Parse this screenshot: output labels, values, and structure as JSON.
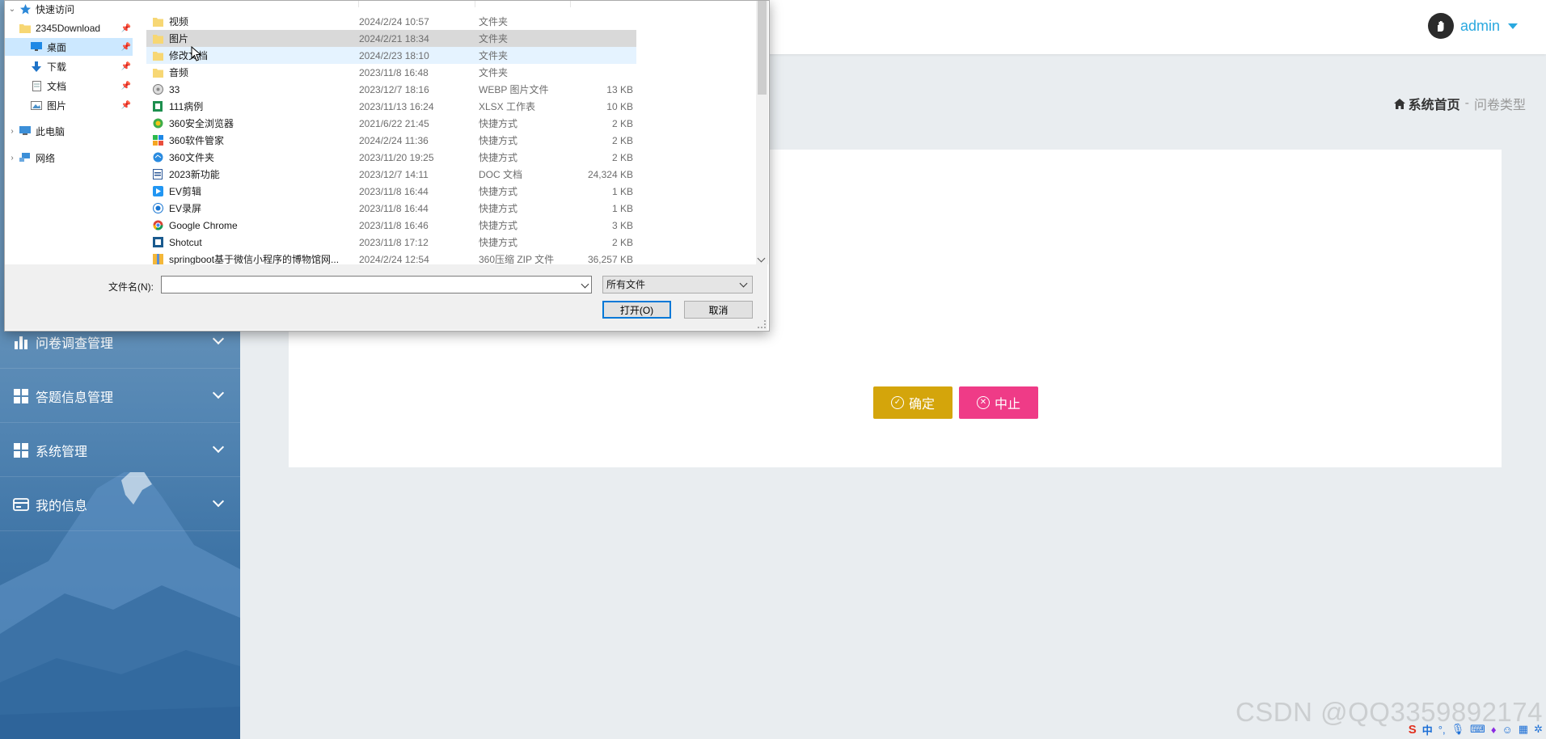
{
  "header": {
    "username": "admin",
    "breadcrumb_home": "系统首页",
    "breadcrumb_sep": "-",
    "breadcrumb_current": "问卷类型"
  },
  "sidebar": {
    "items": [
      {
        "label": "问卷调查管理",
        "icon": "bar-chart-icon"
      },
      {
        "label": "答题信息管理",
        "icon": "grid-icon"
      },
      {
        "label": "系统管理",
        "icon": "grid-icon"
      },
      {
        "label": "我的信息",
        "icon": "id-card-icon"
      }
    ]
  },
  "actions": {
    "confirm_label": "确定",
    "stop_label": "中止"
  },
  "dialog": {
    "nav": [
      {
        "label": "快速访问",
        "icon": "star-icon",
        "expanded": true
      },
      {
        "label": "2345Download",
        "icon": "folder-icon",
        "pinned": true
      },
      {
        "label": "桌面",
        "icon": "desktop-icon",
        "pinned": true,
        "selected": true
      },
      {
        "label": "下载",
        "icon": "download-icon",
        "pinned": true
      },
      {
        "label": "文档",
        "icon": "document-icon",
        "pinned": true
      },
      {
        "label": "图片",
        "icon": "picture-icon",
        "pinned": true
      },
      {
        "label": "此电脑",
        "icon": "computer-icon",
        "expanded": false
      },
      {
        "label": "网络",
        "icon": "network-icon",
        "expanded": false
      }
    ],
    "files": [
      {
        "name": "视频",
        "date": "2024/2/24 10:57",
        "type": "文件夹",
        "size": "",
        "icon": "folder"
      },
      {
        "name": "图片",
        "date": "2024/2/21 18:34",
        "type": "文件夹",
        "size": "",
        "icon": "folder"
      },
      {
        "name": "修改文档",
        "date": "2024/2/23 18:10",
        "type": "文件夹",
        "size": "",
        "icon": "folder"
      },
      {
        "name": "音频",
        "date": "2023/11/8 16:48",
        "type": "文件夹",
        "size": "",
        "icon": "folder"
      },
      {
        "name": "33",
        "date": "2023/12/7 18:16",
        "type": "WEBP 图片文件",
        "size": "13 KB",
        "icon": "webp"
      },
      {
        "name": "111病例",
        "date": "2023/11/13 16:24",
        "type": "XLSX 工作表",
        "size": "10 KB",
        "icon": "xlsx"
      },
      {
        "name": "360安全浏览器",
        "date": "2021/6/22 21:45",
        "type": "快捷方式",
        "size": "2 KB",
        "icon": "browser360"
      },
      {
        "name": "360软件管家",
        "date": "2024/2/24 11:36",
        "type": "快捷方式",
        "size": "2 KB",
        "icon": "softmgr"
      },
      {
        "name": "360文件夹",
        "date": "2023/11/20 19:25",
        "type": "快捷方式",
        "size": "2 KB",
        "icon": "folder360"
      },
      {
        "name": "2023新功能",
        "date": "2023/12/7 14:11",
        "type": "DOC 文档",
        "size": "24,324 KB",
        "icon": "doc"
      },
      {
        "name": "EV剪辑",
        "date": "2023/11/8 16:44",
        "type": "快捷方式",
        "size": "1 KB",
        "icon": "ev"
      },
      {
        "name": "EV录屏",
        "date": "2023/11/8 16:44",
        "type": "快捷方式",
        "size": "1 KB",
        "icon": "ev2"
      },
      {
        "name": "Google Chrome",
        "date": "2023/11/8 16:46",
        "type": "快捷方式",
        "size": "3 KB",
        "icon": "chrome"
      },
      {
        "name": "Shotcut",
        "date": "2023/11/8 17:12",
        "type": "快捷方式",
        "size": "2 KB",
        "icon": "shotcut"
      },
      {
        "name": "springboot基于微信小程序的博物馆网...",
        "date": "2024/2/24 12:54",
        "type": "360压缩 ZIP 文件",
        "size": "36,257 KB",
        "icon": "zip"
      }
    ],
    "filename_label": "文件名(N):",
    "filename_value": "",
    "filetype_value": "所有文件",
    "open_label": "打开(O)",
    "cancel_label": "取消"
  },
  "watermark": "CSDN @QQ3359892174",
  "tray": {
    "ime_label": "中",
    "punct_label": "°,"
  },
  "colors": {
    "accent": "#29a8df",
    "confirm": "#d4a50b",
    "stop": "#ef3b87",
    "sidebar": "#5587b4",
    "selected": "#cce8ff"
  }
}
